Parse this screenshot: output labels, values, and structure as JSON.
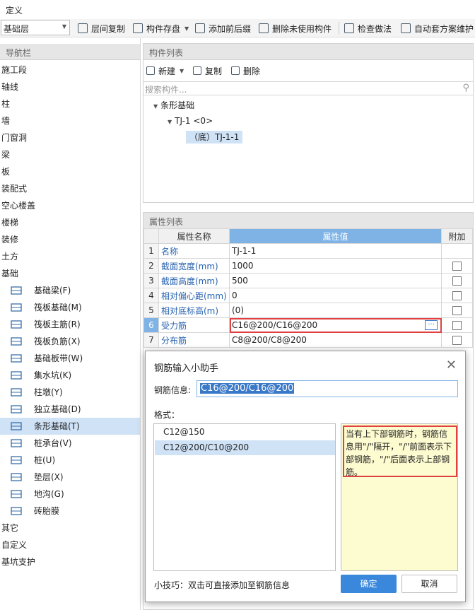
{
  "menubar": {
    "title": "定义"
  },
  "toolbar": {
    "layer_select": "基础层",
    "floor_copy": "层间复制",
    "component_save": "构件存盘",
    "add_prefix_suffix": "添加前后缀",
    "delete_unused": "删除未使用构件",
    "check_method": "检查做法",
    "auto_apply": "自动套方案维护"
  },
  "nav": {
    "header": "导航栏",
    "items": [
      "施工段",
      "轴线",
      "柱",
      "墙",
      "门窗洞",
      "梁",
      "板",
      "装配式",
      "空心楼盖",
      "楼梯",
      "装修",
      "土方",
      "基础"
    ],
    "sub_items": [
      {
        "label": "基础梁(F)",
        "icon": "foundation-beam-icon"
      },
      {
        "label": "筏板基础(M)",
        "icon": "raft-foundation-icon"
      },
      {
        "label": "筏板主筋(R)",
        "icon": "raft-main-rebar-icon"
      },
      {
        "label": "筏板负筋(X)",
        "icon": "raft-negative-rebar-icon"
      },
      {
        "label": "基础板带(W)",
        "icon": "foundation-strip-icon"
      },
      {
        "label": "集水坑(K)",
        "icon": "sump-pit-icon"
      },
      {
        "label": "柱墩(Y)",
        "icon": "column-pier-icon"
      },
      {
        "label": "独立基础(D)",
        "icon": "isolated-footing-icon"
      },
      {
        "label": "条形基础(T)",
        "icon": "strip-footing-icon"
      },
      {
        "label": "桩承台(V)",
        "icon": "pile-cap-icon"
      },
      {
        "label": "桩(U)",
        "icon": "pile-icon"
      },
      {
        "label": "垫层(X)",
        "icon": "cushion-icon"
      },
      {
        "label": "地沟(G)",
        "icon": "trench-icon"
      },
      {
        "label": "砖胎膜",
        "icon": "brick-mould-icon"
      }
    ],
    "after_items": [
      "其它",
      "自定义",
      "基坑支护"
    ]
  },
  "complist": {
    "header": "构件列表",
    "new_label": "新建",
    "copy_label": "复制",
    "delete_label": "删除",
    "search_placeholder": "搜索构件...",
    "tree_root": "条形基础",
    "tree_child": "TJ-1 <0>",
    "tree_leaf": "（底）TJ-1-1"
  },
  "props": {
    "header": "属性列表",
    "col_name": "属性名称",
    "col_value": "属性值",
    "col_extra": "附加",
    "rows": [
      {
        "no": "1",
        "name": "名称",
        "value": "TJ-1-1"
      },
      {
        "no": "2",
        "name": "截面宽度(mm)",
        "value": "1000"
      },
      {
        "no": "3",
        "name": "截面高度(mm)",
        "value": "500"
      },
      {
        "no": "4",
        "name": "相对偏心距(mm)",
        "value": "0"
      },
      {
        "no": "5",
        "name": "相对底标高(m)",
        "value": "(0)"
      },
      {
        "no": "6",
        "name": "受力筋",
        "value": "C16@200/C16@200"
      },
      {
        "no": "7",
        "name": "分布筋",
        "value": "C8@200/C8@200"
      }
    ],
    "ellipsis": "···"
  },
  "dialog": {
    "title": "钢筋输入小助手",
    "info_label": "钢筋信息:",
    "info_value": "C16@200/C16@200",
    "format_label": "格式：",
    "formats": [
      "C12@150",
      "C12@200/C10@200"
    ],
    "hint": "当有上下部钢筋时，钢筋信息用\"/\"隔开，\"/\"前面表示下部钢筋，\"/\"后面表示上部钢筋。",
    "tip": "小技巧：双击可直接添加至钢筋信息",
    "ok": "确定",
    "cancel": "取消"
  }
}
